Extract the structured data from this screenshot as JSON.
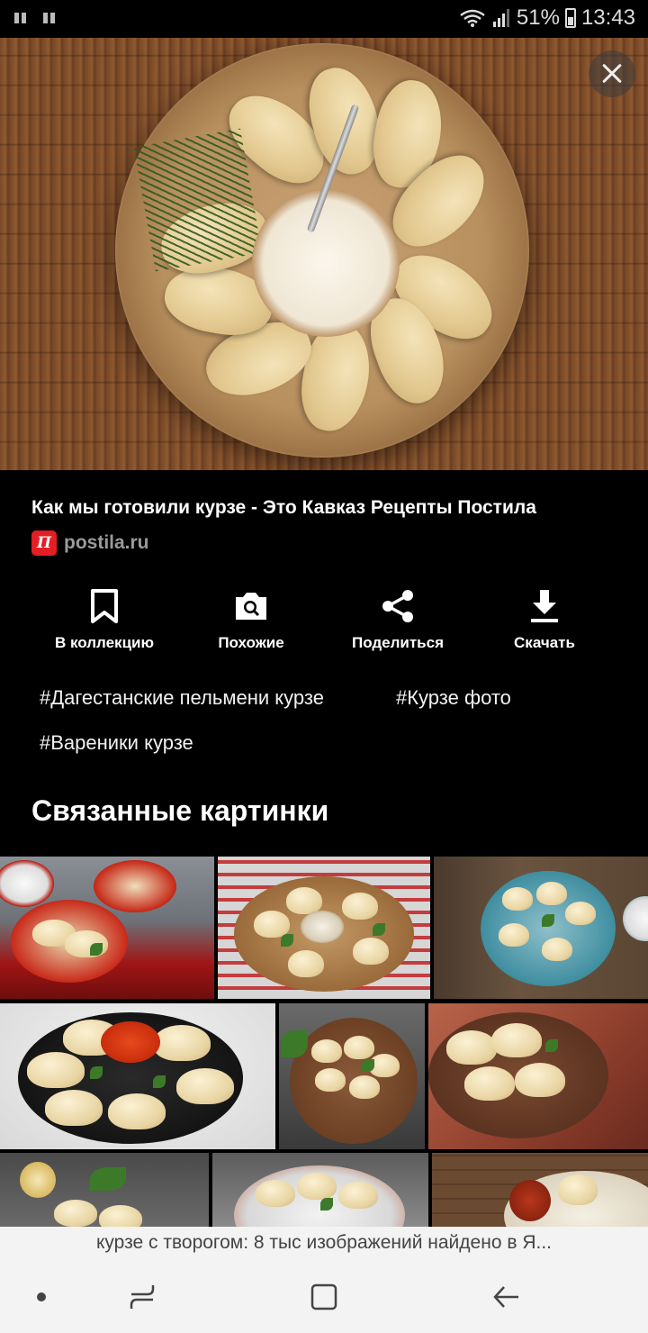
{
  "status_bar": {
    "battery_percent": "51%",
    "time": "13:43"
  },
  "image_title": "Как мы готовили курзе - Это Кавказ Рецепты Постила",
  "source": {
    "logo_glyph": "П",
    "domain": "postila.ru",
    "logo_color": "#e31e24"
  },
  "actions": [
    {
      "label": "В коллекцию",
      "icon": "bookmark-icon"
    },
    {
      "label": "Похожие",
      "icon": "camera-search-icon"
    },
    {
      "label": "Поделиться",
      "icon": "share-icon"
    },
    {
      "label": "Скачать",
      "icon": "download-icon"
    }
  ],
  "tags": [
    "#Дагестанские пельмени курзе",
    "#Курзе фото",
    "#Вареники курзе"
  ],
  "related_title": "Связанные картинки",
  "search_caption": "курзе с творогом: 8 тыс изображений найдено в Я...",
  "nav": {
    "home_icon": "dot-icon",
    "recents_icon": "recents-icon",
    "overview_icon": "square-icon",
    "back_icon": "back-arrow-icon"
  }
}
